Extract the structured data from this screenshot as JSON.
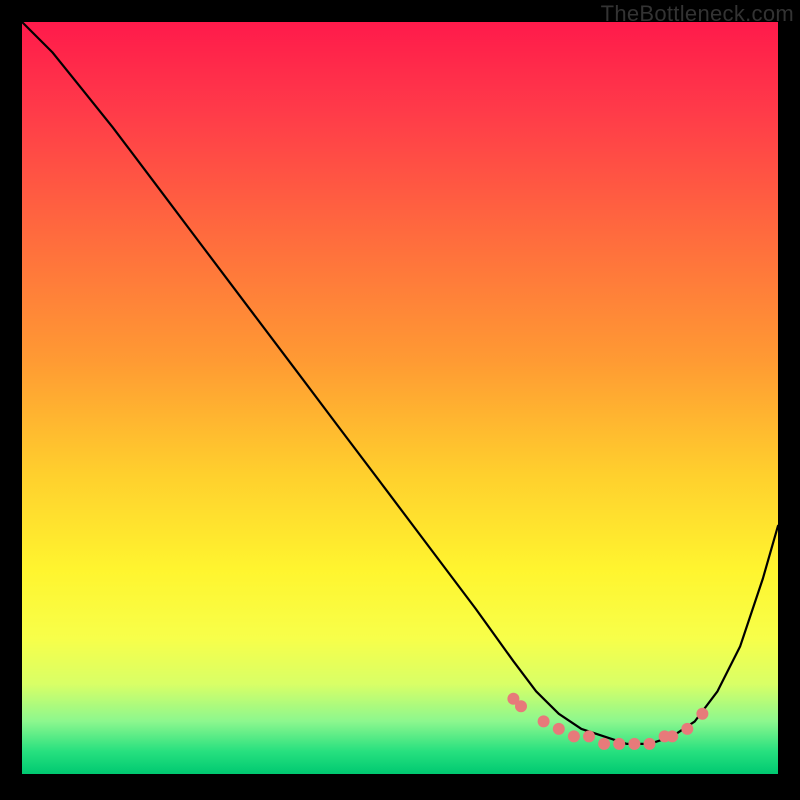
{
  "watermark": "TheBottleneck.com",
  "chart_data": {
    "type": "line",
    "title": "",
    "xlabel": "",
    "ylabel": "",
    "xlim": [
      0,
      100
    ],
    "ylim": [
      0,
      100
    ],
    "background_gradient": {
      "stops": [
        {
          "offset": 0.0,
          "color": "#ff1a4b"
        },
        {
          "offset": 0.12,
          "color": "#ff3b49"
        },
        {
          "offset": 0.28,
          "color": "#ff6a3e"
        },
        {
          "offset": 0.45,
          "color": "#ff9a33"
        },
        {
          "offset": 0.6,
          "color": "#ffcf2d"
        },
        {
          "offset": 0.73,
          "color": "#fff52f"
        },
        {
          "offset": 0.82,
          "color": "#f7ff4a"
        },
        {
          "offset": 0.88,
          "color": "#d9ff66"
        },
        {
          "offset": 0.93,
          "color": "#8cf78e"
        },
        {
          "offset": 0.97,
          "color": "#27e07f"
        },
        {
          "offset": 1.0,
          "color": "#00c971"
        }
      ]
    },
    "series": [
      {
        "name": "bottleneck-curve",
        "color": "#000000",
        "stroke_width": 2.2,
        "x": [
          0,
          4,
          8,
          12,
          18,
          24,
          30,
          36,
          42,
          48,
          54,
          60,
          65,
          68,
          71,
          74,
          77,
          80,
          83,
          86,
          89,
          92,
          95,
          98,
          100
        ],
        "y": [
          100,
          96,
          91,
          86,
          78,
          70,
          62,
          54,
          46,
          38,
          30,
          22,
          15,
          11,
          8,
          6,
          5,
          4,
          4,
          5,
          7,
          11,
          17,
          26,
          33
        ]
      }
    ],
    "markers": {
      "name": "sample-dots",
      "color": "#e77a7a",
      "radius": 6,
      "x": [
        65,
        66,
        69,
        71,
        73,
        75,
        77,
        79,
        81,
        83,
        85,
        86,
        88,
        90
      ],
      "y": [
        10,
        9,
        7,
        6,
        5,
        5,
        4,
        4,
        4,
        4,
        5,
        5,
        6,
        8
      ]
    }
  }
}
